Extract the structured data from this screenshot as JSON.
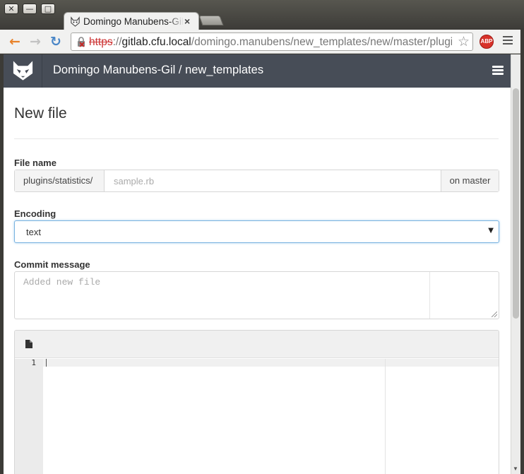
{
  "window": {
    "close_glyph": "✕",
    "minimize_glyph": "—",
    "maximize_glyph": "□"
  },
  "browser": {
    "tab_title": "Domingo Manubens-Gil",
    "tab_close_glyph": "×",
    "url_scheme": "https",
    "url_sep": "://",
    "url_host": "gitlab.cfu.local",
    "url_path": "/domingo.manubens/new_templates/new/master/plugins/statistics/",
    "back_glyph": "←",
    "forward_glyph": "→",
    "reload_glyph": "↻",
    "star_glyph": "☆",
    "adblock_label": "ABP",
    "icons": {
      "back": "arrow-left-icon",
      "forward": "arrow-right-icon",
      "reload": "reload-icon",
      "bookmark": "star-icon",
      "menu": "hamburger-menu-icon",
      "security": "broken-lock-icon"
    },
    "accent": {
      "back_arrow": "#e8822a",
      "reload": "#4a86c7",
      "scheme_error": "#cc3333"
    }
  },
  "gitlab": {
    "header_title": "Domingo Manubens-Gil / new_templates",
    "header_bg": "#474d57",
    "page_title": "New file",
    "file_name_label": "File name",
    "path_prefix": "plugins/statistics/",
    "file_name_value": "",
    "file_name_placeholder": "sample.rb",
    "branch_label": "on master",
    "encoding_label": "Encoding",
    "encoding_value": "text",
    "encoding_caret": "▼",
    "commit_label": "Commit message",
    "commit_value": "",
    "commit_placeholder": "Added new file",
    "editor": {
      "line_numbers": [
        "1"
      ],
      "content": ""
    }
  }
}
